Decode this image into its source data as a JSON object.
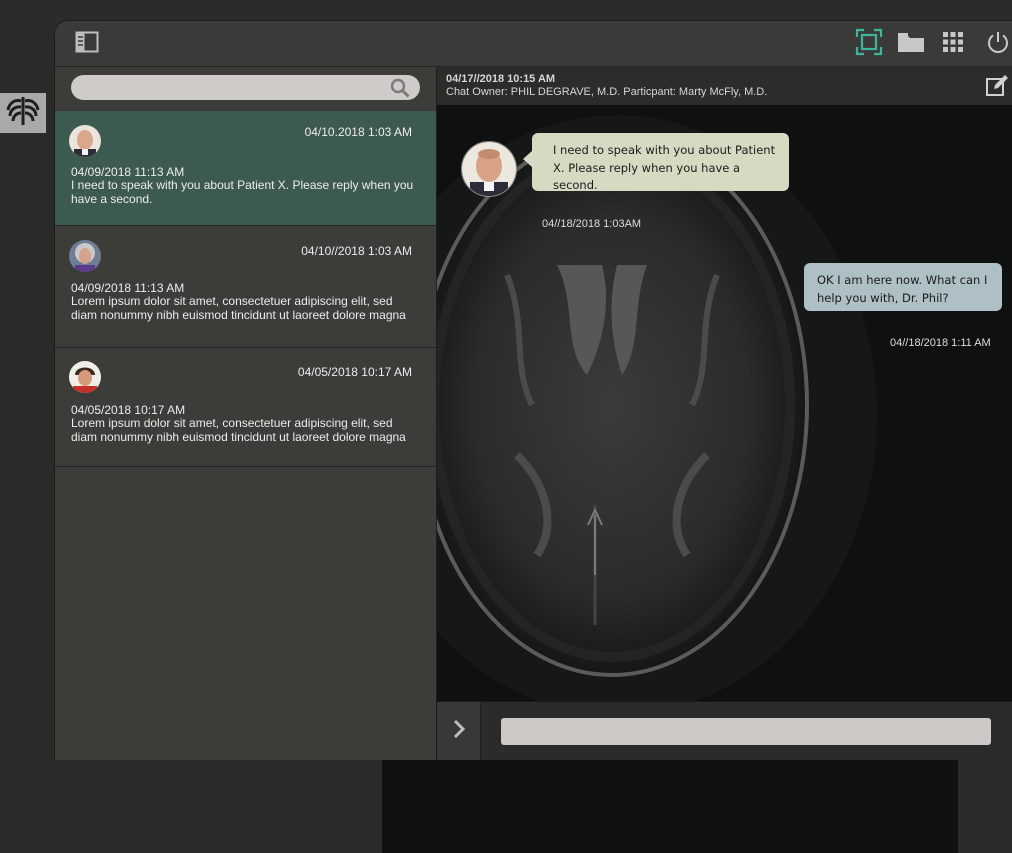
{
  "sidebar": {
    "items": [
      {
        "icon": "ribcage-icon",
        "active": true
      },
      {
        "icon": "chat-bubble-icon",
        "accent": "#3fb59a"
      }
    ]
  },
  "toolbar": {
    "icons": [
      "panel-toggle-icon",
      "fullscreen-icon",
      "folder-icon",
      "grid-apps-icon",
      "power-icon"
    ],
    "accent": "#3fb59a"
  },
  "search": {
    "placeholder": ""
  },
  "conversations": [
    {
      "date": "04/10.2018 1:03 AM",
      "stamp": "04/09/2018 11:13 AM",
      "preview": "I need to speak with you about  Patient  X.  Please reply when you have a second.",
      "selected": true
    },
    {
      "date": "04/10//2018 1:03 AM",
      "stamp": "04/09/2018 11:13 AM",
      "preview": "Lorem ipsum dolor sit amet, consectetuer adipiscing elit, sed diam nonummy nibh euismod tincidunt ut laoreet dolore magna"
    },
    {
      "date": "04/05/2018 10:17 AM",
      "stamp": "04/05/2018 10:17 AM",
      "preview": "Lorem ipsum dolor sit amet, consectetuer adipiscing elit, sed diam nonummy nibh euismod tincidunt ut laoreet dolore magna"
    }
  ],
  "chat": {
    "when": "04/17//2018  10:15 AM",
    "participants": "Chat Owner: PHIL DEGRAVE, M.D. Particpant: Marty McFly, M.D.",
    "messages": [
      {
        "direction": "in",
        "text": "I need to speak with you about  Patient  X.  Please reply when you have a second.",
        "time": "04//18/2018  1:03AM"
      },
      {
        "direction": "out",
        "text": "OK I am here now. What can I help you with, Dr. Phil?",
        "time": "04//18/2018  1:11 AM"
      }
    ]
  },
  "composer": {
    "placeholder": "",
    "value": ""
  },
  "colors": {
    "accent": "#3fb59a",
    "selected_row": "#3d5a50",
    "incoming_bubble": "#d7d9c3",
    "outgoing_bubble": "#aebfc6"
  }
}
